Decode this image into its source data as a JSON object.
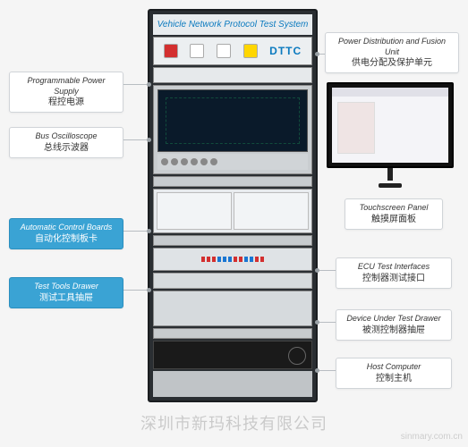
{
  "rack": {
    "title": "Vehicle Network Protocol Test System",
    "brand": "DTTC"
  },
  "labels": {
    "pdu": {
      "en": "Power Distribution and Fusion Unit",
      "cn": "供电分配及保护单元"
    },
    "psu": {
      "en": "Programmable Power Supply",
      "cn": "程控电源"
    },
    "osc": {
      "en": "Bus Oscilloscope",
      "cn": "总线示波器"
    },
    "acb": {
      "en": "Automatic Control Boards",
      "cn": "自动化控制板卡"
    },
    "ttd": {
      "en": "Test Tools Drawer",
      "cn": "测试工具抽屉"
    },
    "tsp": {
      "en": "Touchscreen Panel",
      "cn": "触摸屏面板"
    },
    "ecu": {
      "en": "ECU Test Interfaces",
      "cn": "控制器测试接口"
    },
    "dut": {
      "en": "Device Under Test Drawer",
      "cn": "被测控制器抽屉"
    },
    "host": {
      "en": "Host Computer",
      "cn": "控制主机"
    }
  },
  "watermark": {
    "main": "深圳市新玛科技有限公司",
    "site": "sinmary.com.cn"
  }
}
